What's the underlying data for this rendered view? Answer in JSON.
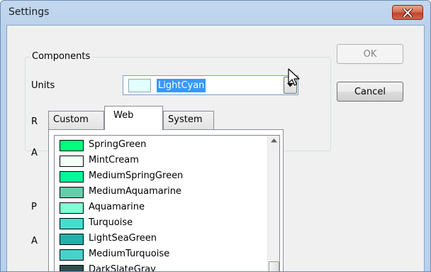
{
  "window": {
    "title": "Settings"
  },
  "group": {
    "legend": "Components"
  },
  "labels": {
    "units": "Units",
    "r": "R",
    "a1": "A",
    "p": "P",
    "a2": "A"
  },
  "combo": {
    "selected": "LightCyan",
    "selected_color": "#E0FFFF"
  },
  "buttons": {
    "ok": "OK",
    "cancel": "Cancel"
  },
  "tabs": [
    {
      "label": "Custom"
    },
    {
      "label": "Web"
    },
    {
      "label": "System"
    }
  ],
  "active_tab": "Web",
  "colors": [
    {
      "name": "SpringGreen",
      "hex": "#00FF7F"
    },
    {
      "name": "MintCream",
      "hex": "#F5FFFA"
    },
    {
      "name": "MediumSpringGreen",
      "hex": "#00FA9A"
    },
    {
      "name": "MediumAquamarine",
      "hex": "#66CDAA"
    },
    {
      "name": "Aquamarine",
      "hex": "#7FFFD4"
    },
    {
      "name": "Turquoise",
      "hex": "#40E0D0"
    },
    {
      "name": "LightSeaGreen",
      "hex": "#20B2AA"
    },
    {
      "name": "MediumTurquoise",
      "hex": "#48D1CC"
    },
    {
      "name": "DarkSlateGray",
      "hex": "#2F4F4F"
    }
  ],
  "icons": {
    "close": "close-icon",
    "dropdown": "chevron-down-icon",
    "scroll_up": "scroll-up-arrow-icon",
    "cursor": "mouse-pointer-icon"
  }
}
